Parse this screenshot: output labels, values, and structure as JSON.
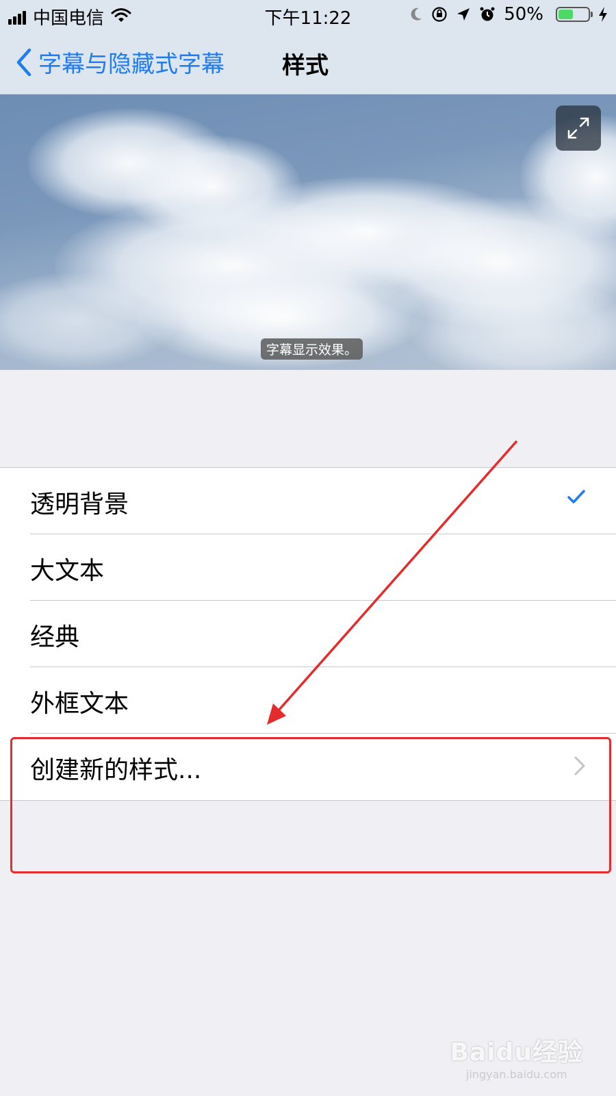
{
  "status_bar": {
    "carrier": "中国电信",
    "time": "下午11:22",
    "battery_percent_text": "50%",
    "battery_level": 0.5,
    "icons": [
      "signal-icon",
      "wifi-icon",
      "moon-icon",
      "rotation-lock-icon",
      "location-icon",
      "alarm-icon",
      "charging-icon"
    ]
  },
  "nav": {
    "back_label": "字幕与隐藏式字幕",
    "title": "样式"
  },
  "preview": {
    "caption": "字幕显示效果。"
  },
  "styles": {
    "items": [
      {
        "label": "透明背景",
        "selected": true
      },
      {
        "label": "大文本",
        "selected": false
      },
      {
        "label": "经典",
        "selected": false
      },
      {
        "label": "外框文本",
        "selected": false
      }
    ],
    "create_label": "创建新的样式..."
  },
  "watermark": {
    "brand": "Baidu经验",
    "url": "jingyan.baidu.com"
  },
  "colors": {
    "accent": "#1e7cf2",
    "annotation": "#e52c2c",
    "battery_fill": "#4cd964"
  }
}
